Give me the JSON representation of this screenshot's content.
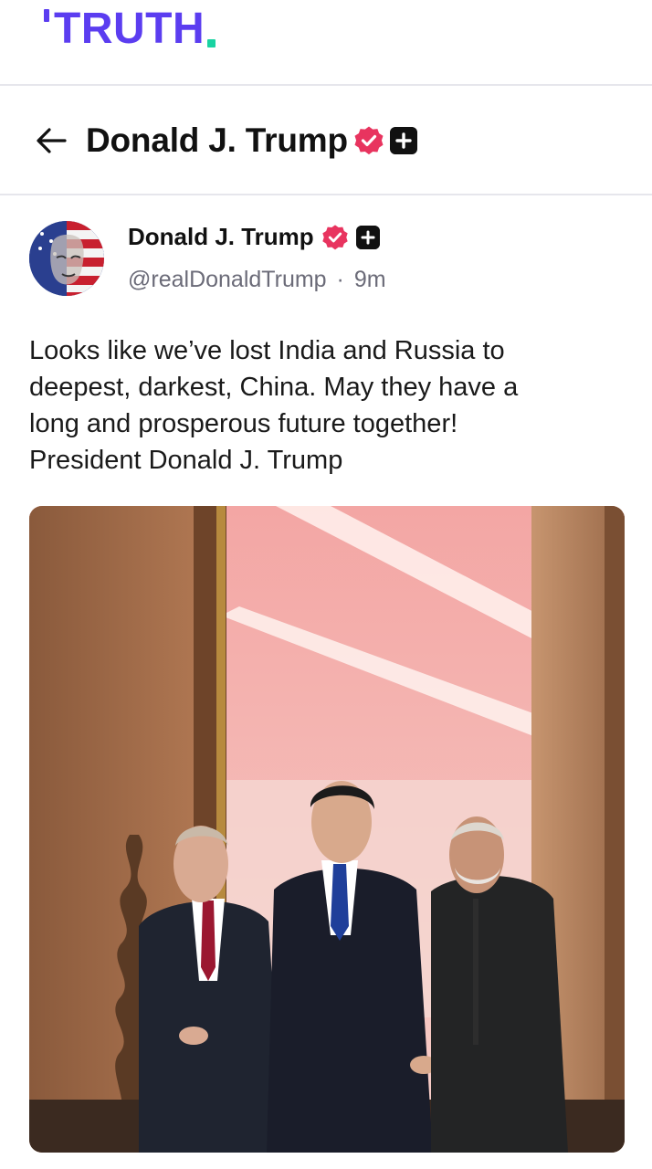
{
  "brand": {
    "logo_text": "TRUTH"
  },
  "header": {
    "title": "Donald J. Trump",
    "back_icon": "back-arrow-icon"
  },
  "post": {
    "author_name": "Donald J. Trump",
    "handle": "@realDonaldTrump",
    "separator": "·",
    "time_ago": "9m",
    "text_lines": [
      "Looks like we’ve lost India and Russia to",
      "deepest, darkest, China. May they have a",
      "long and prosperous future together!",
      "President Donald J. Trump"
    ]
  },
  "colors": {
    "brand_purple": "#5b3df0",
    "brand_green": "#19d3a2",
    "verified_pink": "#e8345f"
  }
}
